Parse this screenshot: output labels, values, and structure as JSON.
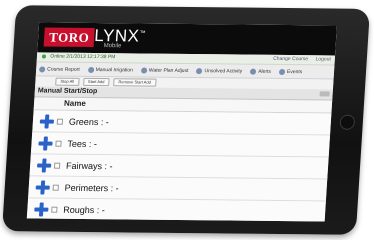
{
  "app": {
    "brand": "TORO",
    "name": "LYNX",
    "trademark": "™",
    "subtitle": "Mobile"
  },
  "status": {
    "text": "Online 2/1/2013 12:17:38 PM",
    "links": [
      "Change Course",
      "Logout"
    ]
  },
  "toolbar": {
    "items": [
      "Course Report",
      "Manual Irrigation",
      "Water Plan Adjust",
      "Unsolved Activity",
      "Alerts",
      "Events"
    ]
  },
  "subtoolbar": {
    "buttons": [
      "Stop All",
      "Start Add",
      "Remove Start Add"
    ]
  },
  "section": {
    "title": "Manual Start/Stop"
  },
  "table": {
    "column": "Name",
    "rows": [
      "Greens : -",
      "Tees : -",
      "Fairways : -",
      "Perimeters : -",
      "Roughs : -"
    ]
  },
  "colors": {
    "brand_red": "#c8102e",
    "expand_blue": "#2a62c9",
    "header_bg": "#0b0b0b"
  }
}
